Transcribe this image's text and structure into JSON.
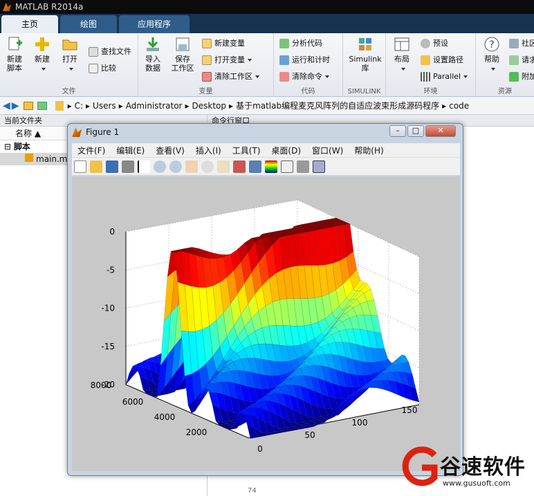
{
  "app": {
    "title": "MATLAB R2014a"
  },
  "tabs": [
    {
      "label": "主页",
      "active": true
    },
    {
      "label": "绘图",
      "active": false
    },
    {
      "label": "应用程序",
      "active": false
    }
  ],
  "ribbon": {
    "file": {
      "label": "文件",
      "new_script": "新建\n脚本",
      "new": "新建",
      "open": "打开",
      "find_files": "查找文件",
      "compare": "比较"
    },
    "variable": {
      "label": "变量",
      "import": "导入\n数据",
      "save": "保存\n工作区",
      "new_var": "新建变量",
      "open_var": "打开变量",
      "clear_ws": "清除工作区"
    },
    "code": {
      "label": "代码",
      "analyze": "分析代码",
      "run_time": "运行和计时",
      "clear_cmd": "清除命令"
    },
    "simulink": {
      "label": "SIMULINK",
      "lib": "Simulink\n库"
    },
    "env": {
      "label": "环境",
      "layout": "布局",
      "prefs": "预设",
      "set_path": "设置路径",
      "parallel": "Parallel"
    },
    "resources": {
      "label": "资源",
      "help": "帮助",
      "community": "社区",
      "request": "请求",
      "addons": "附加"
    }
  },
  "address": {
    "path": [
      "C:",
      "Users",
      "Administrator",
      "Desktop",
      "基于matlab编程麦克风阵列的自适应波束形成源码程序",
      "code"
    ]
  },
  "left_panel": {
    "title": "当前文件夹",
    "col_name": "名称",
    "group": "脚本",
    "file": "main.m"
  },
  "cmd_panel": {
    "title": "命令行窗口",
    "line_num": "74"
  },
  "figure": {
    "title": "Figure 1",
    "menu": [
      "文件(F)",
      "编辑(E)",
      "查看(V)",
      "插入(I)",
      "工具(T)",
      "桌面(D)",
      "窗口(W)",
      "帮助(H)"
    ]
  },
  "chart_data": {
    "type": "surface",
    "z_ticks": [
      "0",
      "-5",
      "-10",
      "-15",
      "-20"
    ],
    "zlim": [
      -20,
      0
    ],
    "y_ticks": [
      "8000",
      "6000",
      "4000",
      "2000"
    ],
    "ylim": [
      0,
      8000
    ],
    "x_ticks": [
      "0",
      "50",
      "100",
      "150"
    ],
    "xlim": [
      0,
      180
    ],
    "colormap": "jet",
    "grid": true
  },
  "watermark": {
    "brand": "谷速软件",
    "url": "www.gusuoft.com"
  },
  "colors": {
    "tab_bar": "#16324f",
    "accent": "#2f5d8a",
    "surface_high": "#c80000",
    "surface_low": "#0000c8"
  }
}
